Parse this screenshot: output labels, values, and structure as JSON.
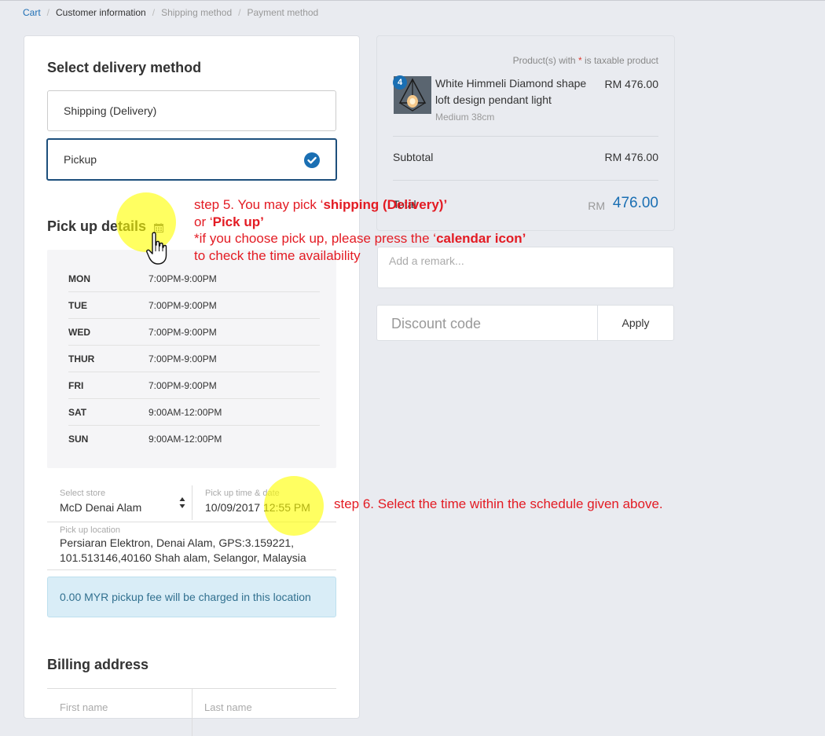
{
  "breadcrumb": {
    "items": [
      "Cart",
      "Customer information",
      "Shipping method",
      "Payment method"
    ]
  },
  "delivery": {
    "title": "Select delivery method",
    "options": [
      "Shipping (Delivery)",
      "Pickup"
    ],
    "selected": "Pickup"
  },
  "pickup": {
    "title": "Pick up details",
    "schedule": [
      {
        "day": "MON",
        "time": "7:00PM-9:00PM"
      },
      {
        "day": "TUE",
        "time": "7:00PM-9:00PM"
      },
      {
        "day": "WED",
        "time": "7:00PM-9:00PM"
      },
      {
        "day": "THUR",
        "time": "7:00PM-9:00PM"
      },
      {
        "day": "FRI",
        "time": "7:00PM-9:00PM"
      },
      {
        "day": "SAT",
        "time": "9:00AM-12:00PM"
      },
      {
        "day": "SUN",
        "time": "9:00AM-12:00PM"
      }
    ],
    "store_label": "Select store",
    "store_value": "McD Denai Alam",
    "time_label": "Pick up time & date",
    "time_value": "10/09/2017 12:55 PM",
    "location_label": "Pick up location",
    "location_line1": "Persiaran Elektron, Denai Alam, GPS:3.159221,",
    "location_line2": "101.513146,40160 Shah alam, Selangor, Malaysia",
    "fee_note": "0.00 MYR pickup fee will be charged in this location"
  },
  "billing": {
    "title": "Billing address",
    "first_name_label": "First name",
    "last_name_label": "Last name"
  },
  "summary": {
    "taxable_note_prefix": "Product(s) with ",
    "taxable_note_star": "*",
    "taxable_note_suffix": " is taxable product",
    "product": {
      "quantity": "4",
      "name": "White Himmeli Diamond shape loft design pendant light",
      "variant": "Medium 38cm",
      "price": "RM 476.00"
    },
    "subtotal_label": "Subtotal",
    "subtotal_value": "RM 476.00",
    "total_label": "Total",
    "total_currency": "RM",
    "total_value": "476.00"
  },
  "remark": {
    "placeholder": "Add a remark..."
  },
  "discount": {
    "placeholder": "Discount code",
    "apply_label": "Apply"
  },
  "annotations": {
    "step5_line1_prefix": "step 5. You may pick ‘",
    "step5_line1_bold": "shipping (Delivery)’",
    "step5_line2_prefix": "or ‘",
    "step5_line2_bold": "Pick up’",
    "step5_line3_prefix": "*if you choose pick up, please press the ‘",
    "step5_line3_bold": "calendar icon’",
    "step5_line4": "to check the time availability",
    "step6": "step 6. Select the time within the schedule given above."
  },
  "colors": {
    "accent": "#1a6fb3",
    "selected_border": "#1d4f7c",
    "annotation": "#e31b23",
    "highlight": "#ffff00",
    "info_background": "#d9edf7"
  },
  "icons": [
    "calendar-icon",
    "check-circle-icon",
    "sort-arrows-icon",
    "pointer-hand-icon"
  ]
}
